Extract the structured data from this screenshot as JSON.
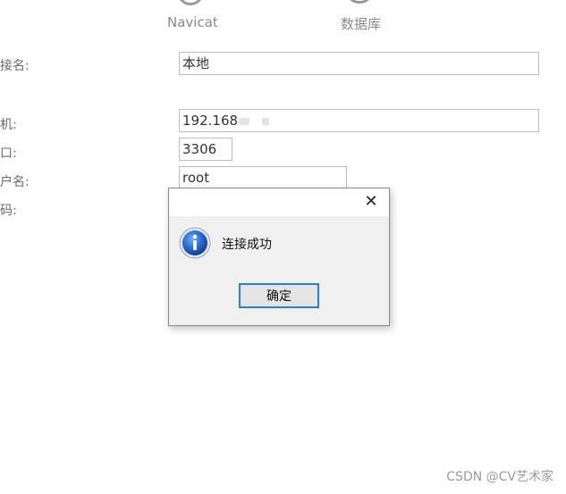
{
  "diagram": {
    "left_label": "Navicat",
    "right_label": "数据库",
    "left_icon": "navicat-app-icon",
    "right_icon": "database-icon"
  },
  "form": {
    "connection_name": {
      "label": "连接名:",
      "value": "本地"
    },
    "host": {
      "label": "主机:",
      "value": "192.168"
    },
    "port": {
      "label": "端口:",
      "value": "3306"
    },
    "username": {
      "label": "用户名:",
      "value": "root"
    },
    "password": {
      "label": "密码:"
    }
  },
  "dialog": {
    "message": "连接成功",
    "ok_label": "确定",
    "close_glyph": "✕",
    "icon": "info-icon",
    "accent_color": "#2f7fd0"
  },
  "watermark": "CSDN @CV艺术家"
}
